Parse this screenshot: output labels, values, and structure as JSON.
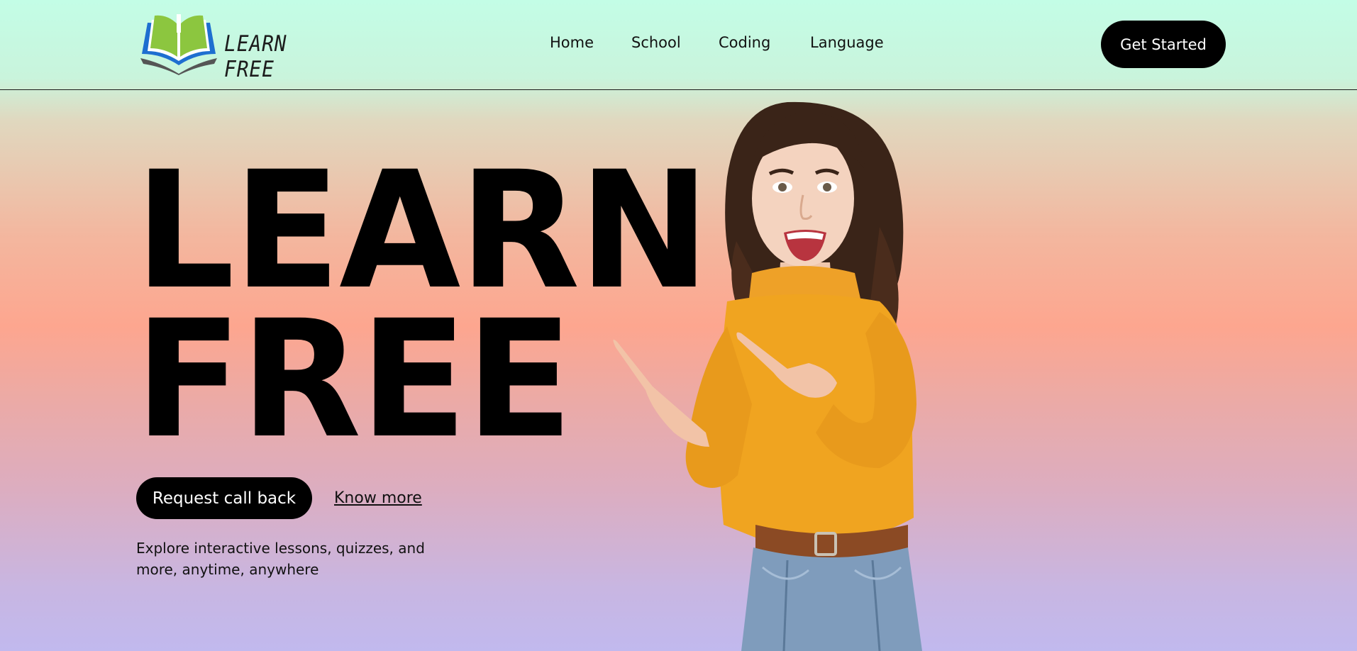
{
  "brand": {
    "name": "LEARN FREE",
    "logo_icon": "open-book-icon"
  },
  "nav": {
    "items": [
      {
        "label": "Home"
      },
      {
        "label": "School"
      },
      {
        "label": "Coding"
      },
      {
        "label": "Language"
      }
    ],
    "cta_label": "Get Started"
  },
  "hero": {
    "title_line1": "LEARN",
    "title_line2": "FREE",
    "callback_label": "Request call back",
    "know_more_label": "Know more",
    "tagline": "Explore interactive lessons, quizzes, and more, anytime, anywhere",
    "image": "woman-pointing-image"
  },
  "colors": {
    "accent": "#000000",
    "logo_green": "#8cc63f",
    "logo_blue": "#1e6fd0",
    "sweater": "#f0a420"
  }
}
